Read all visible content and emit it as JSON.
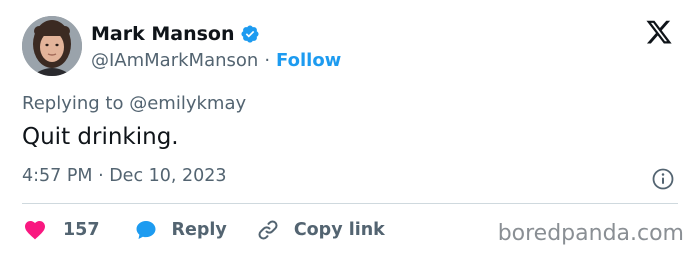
{
  "author": {
    "display_name": "Mark Manson",
    "handle": "@IAmMarkManson",
    "separator": "·",
    "follow_label": "Follow",
    "verified_color": "#1d9bf0"
  },
  "tweet": {
    "replying_prefix": "Replying to",
    "replying_to": "@emilykmay",
    "text": "Quit drinking.",
    "timestamp": "4:57 PM · Dec 10, 2023"
  },
  "actions": {
    "like_count": "157",
    "reply_label": "Reply",
    "copy_label": "Copy link"
  },
  "icons": {
    "platform": "x-logo-icon",
    "verified": "verified-badge-icon",
    "info": "info-icon",
    "like": "heart-icon",
    "reply": "reply-bubble-icon",
    "copy": "link-icon"
  },
  "colors": {
    "like": "#f91880",
    "reply": "#1d9bf0",
    "accent": "#1d9bf0",
    "muted": "#536471"
  },
  "watermark": "boredpanda.com"
}
